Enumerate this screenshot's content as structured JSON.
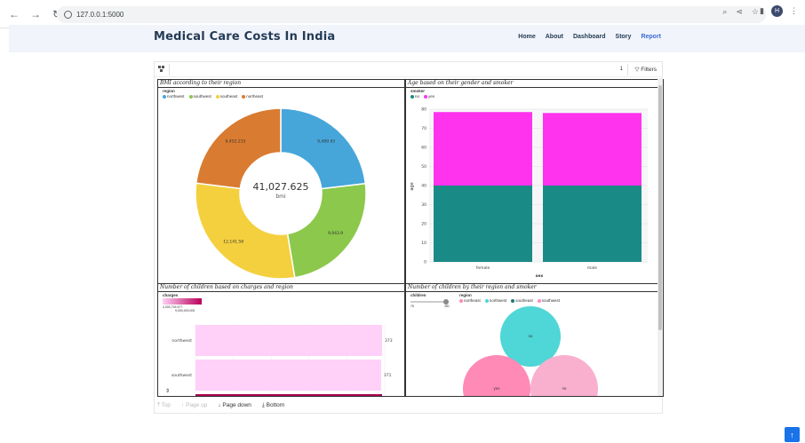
{
  "browser": {
    "url": "127.0.0.1:5000",
    "avatar_letter": "H"
  },
  "header": {
    "title": "Medical Care Costs In India",
    "nav": [
      "Home",
      "About",
      "Dashboard",
      "Story",
      "Report"
    ],
    "active": "Report"
  },
  "toolbar": {
    "page_number": "1",
    "filters_label": "Filters"
  },
  "panels": {
    "bmi": {
      "title": "BMI according to their region",
      "legend_title": "region",
      "legend": [
        {
          "label": "northwest",
          "color": "#46a6da"
        },
        {
          "label": "southwest",
          "color": "#8cc84b"
        },
        {
          "label": "southeast",
          "color": "#f4d03f"
        },
        {
          "label": "northeast",
          "color": "#d97b30"
        }
      ],
      "center_value": "41,027.625",
      "center_label": "bmi",
      "slice_labels": [
        "9,489.93",
        "9,943.9",
        "12,141.58",
        "9,452.215"
      ]
    },
    "age": {
      "title": "Age based on their gender and smoker",
      "legend_title": "smoker",
      "legend": [
        {
          "label": "no",
          "color": "#1a8a87"
        },
        {
          "label": "yes",
          "color": "#ff33ee"
        }
      ],
      "xlabel": "sex",
      "ylabel": "age"
    },
    "children_charges": {
      "title": "Number of children based on charges and region",
      "legend_title": "charges",
      "range_min": "4,000,794.57?",
      "range_max": "9,000,000,000",
      "rows": [
        {
          "label": "northwest",
          "value": "373"
        },
        {
          "label": "southwest",
          "value": "371"
        }
      ]
    },
    "children_region": {
      "title": "Number of children by their region and smoker",
      "legend_title_1": "children",
      "legend_title_2": "region",
      "slider_min": "76",
      "slider_max": "481",
      "legend": [
        {
          "label": "northeast",
          "color": "#ff8ab5"
        },
        {
          "label": "northwest",
          "color": "#4fd6d6"
        },
        {
          "label": "southeast",
          "color": "#1a7a77"
        },
        {
          "label": "southwest",
          "color": "#f98cc2"
        }
      ],
      "bubble_labels": [
        "no",
        "yes",
        "no"
      ]
    }
  },
  "bottom_nav": {
    "top": "Top",
    "page_up": "Page up",
    "page_down": "Page down",
    "bottom": "Bottom"
  },
  "chart_data": [
    {
      "type": "pie",
      "title": "BMI according to their region",
      "categories": [
        "northwest",
        "southwest",
        "southeast",
        "northeast"
      ],
      "values": [
        9489.93,
        9943.9,
        12141.58,
        9452.215
      ],
      "total": 41027.625
    },
    {
      "type": "bar",
      "title": "Age based on their gender and smoker",
      "categories": [
        "female",
        "male"
      ],
      "series": [
        {
          "name": "no",
          "values": [
            40,
            40
          ]
        },
        {
          "name": "yes",
          "values": [
            38.5,
            38
          ]
        }
      ],
      "xlabel": "sex",
      "ylabel": "age",
      "ylim": [
        0,
        80
      ],
      "yticks": [
        0,
        10,
        20,
        30,
        40,
        50,
        60,
        70,
        80
      ]
    },
    {
      "type": "bar",
      "title": "Number of children based on charges and region",
      "categories": [
        "northwest",
        "southwest"
      ],
      "values": [
        373,
        371
      ]
    }
  ]
}
